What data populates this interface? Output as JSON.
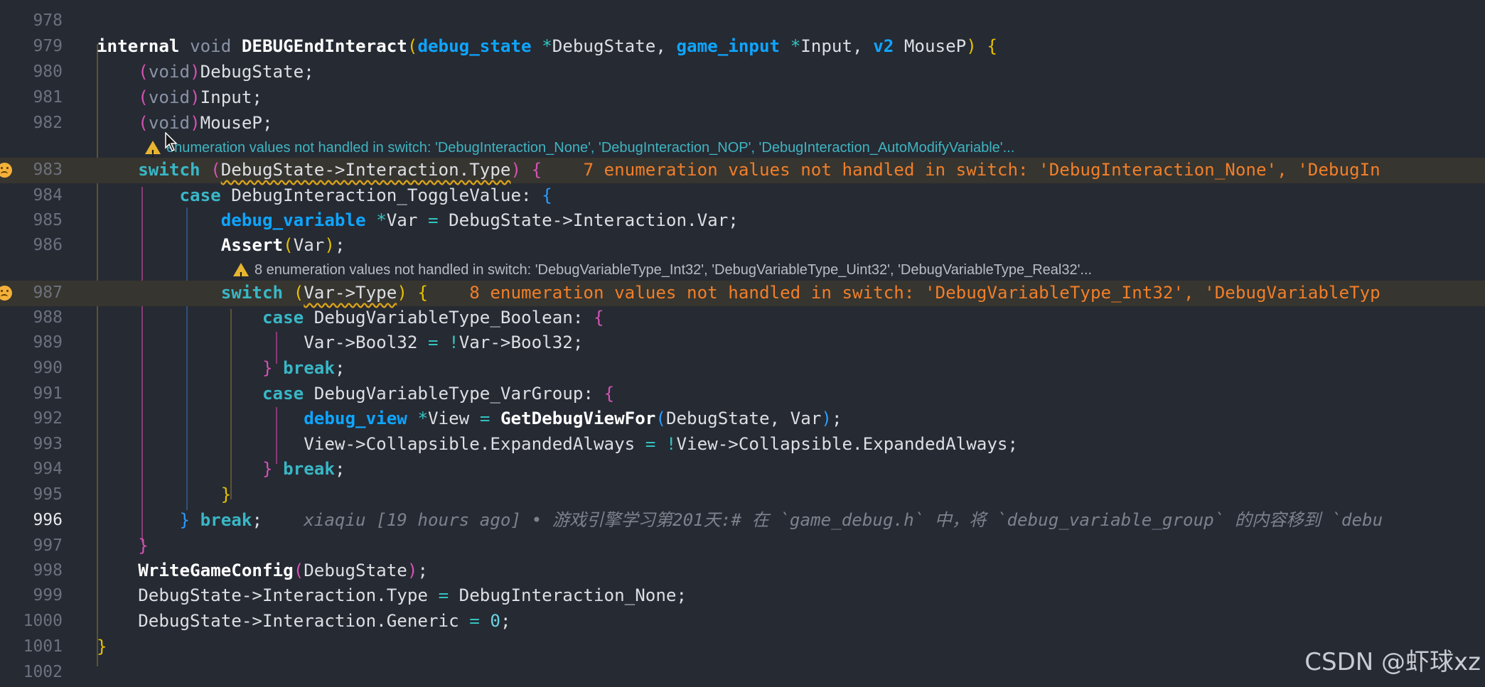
{
  "editor": {
    "lines": [
      {
        "n": "978",
        "t": ""
      },
      {
        "n": "979",
        "t": "internal void DEBUGEndInteract(debug_state *DebugState, game_input *Input, v2 MouseP) {"
      },
      {
        "n": "980",
        "t": "    (void)DebugState;"
      },
      {
        "n": "981",
        "t": "    (void)Input;"
      },
      {
        "n": "982",
        "t": "    (void)MouseP;"
      },
      {
        "n": "983",
        "t": "    switch (DebugState->Interaction.Type) {",
        "err": "7 enumeration values not handled in switch: 'DebugInteraction_None', 'DebugIn"
      },
      {
        "n": "984",
        "t": "        case DebugInteraction_ToggleValue: {"
      },
      {
        "n": "985",
        "t": "            debug_variable *Var = DebugState->Interaction.Var;"
      },
      {
        "n": "986",
        "t": "            Assert(Var);"
      },
      {
        "n": "987",
        "t": "            switch (Var->Type) {",
        "err": "8 enumeration values not handled in switch: 'DebugVariableType_Int32', 'DebugVariableTyp"
      },
      {
        "n": "988",
        "t": "                case DebugVariableType_Boolean: {"
      },
      {
        "n": "989",
        "t": "                    Var->Bool32 = !Var->Bool32;"
      },
      {
        "n": "990",
        "t": "                } break;"
      },
      {
        "n": "991",
        "t": "                case DebugVariableType_VarGroup: {"
      },
      {
        "n": "992",
        "t": "                    debug_view *View = GetDebugViewFor(DebugState, Var);"
      },
      {
        "n": "993",
        "t": "                    View->Collapsible.ExpandedAlways = !View->Collapsible.ExpandedAlways;"
      },
      {
        "n": "994",
        "t": "                } break;"
      },
      {
        "n": "995",
        "t": "            }"
      },
      {
        "n": "996",
        "t": "        } break;",
        "blame": "xiaqiu [19 hours ago] • 游戏引擎学习第201天:# 在 `game_debug.h` 中，将 `debug_variable_group` 的内容移到 `debu"
      },
      {
        "n": "997",
        "t": "    }"
      },
      {
        "n": "998",
        "t": "    WriteGameConfig(DebugState);"
      },
      {
        "n": "999",
        "t": "    DebugState->Interaction.Type = DebugInteraction_None;"
      },
      {
        "n": "1000",
        "t": "    DebugState->Interaction.Generic = 0;"
      },
      {
        "n": "1001",
        "t": "}"
      },
      {
        "n": "1002",
        "t": ""
      }
    ],
    "hints": [
      {
        "before": "983",
        "text": "enumeration values not handled in switch: 'DebugInteraction_None', 'DebugInteraction_NOP', 'DebugInteraction_AutoModifyVariable'..."
      },
      {
        "before": "987",
        "text": "8 enumeration values not handled in switch: 'DebugVariableType_Int32', 'DebugVariableType_Uint32', 'DebugVariableType_Real32'..."
      }
    ],
    "icons": {
      "error_gutter": "sad-face-icon",
      "warning": "warning-triangle-icon",
      "cursor": "mouse-pointer-icon"
    },
    "colors": {
      "background": "#262a33",
      "keyword": "#39b7c6",
      "type": "#0ea5ff",
      "error": "#f07f2a",
      "hint": "#3fb5c1",
      "current_line": "#37352f"
    }
  },
  "watermark": "CSDN @虾球xz"
}
